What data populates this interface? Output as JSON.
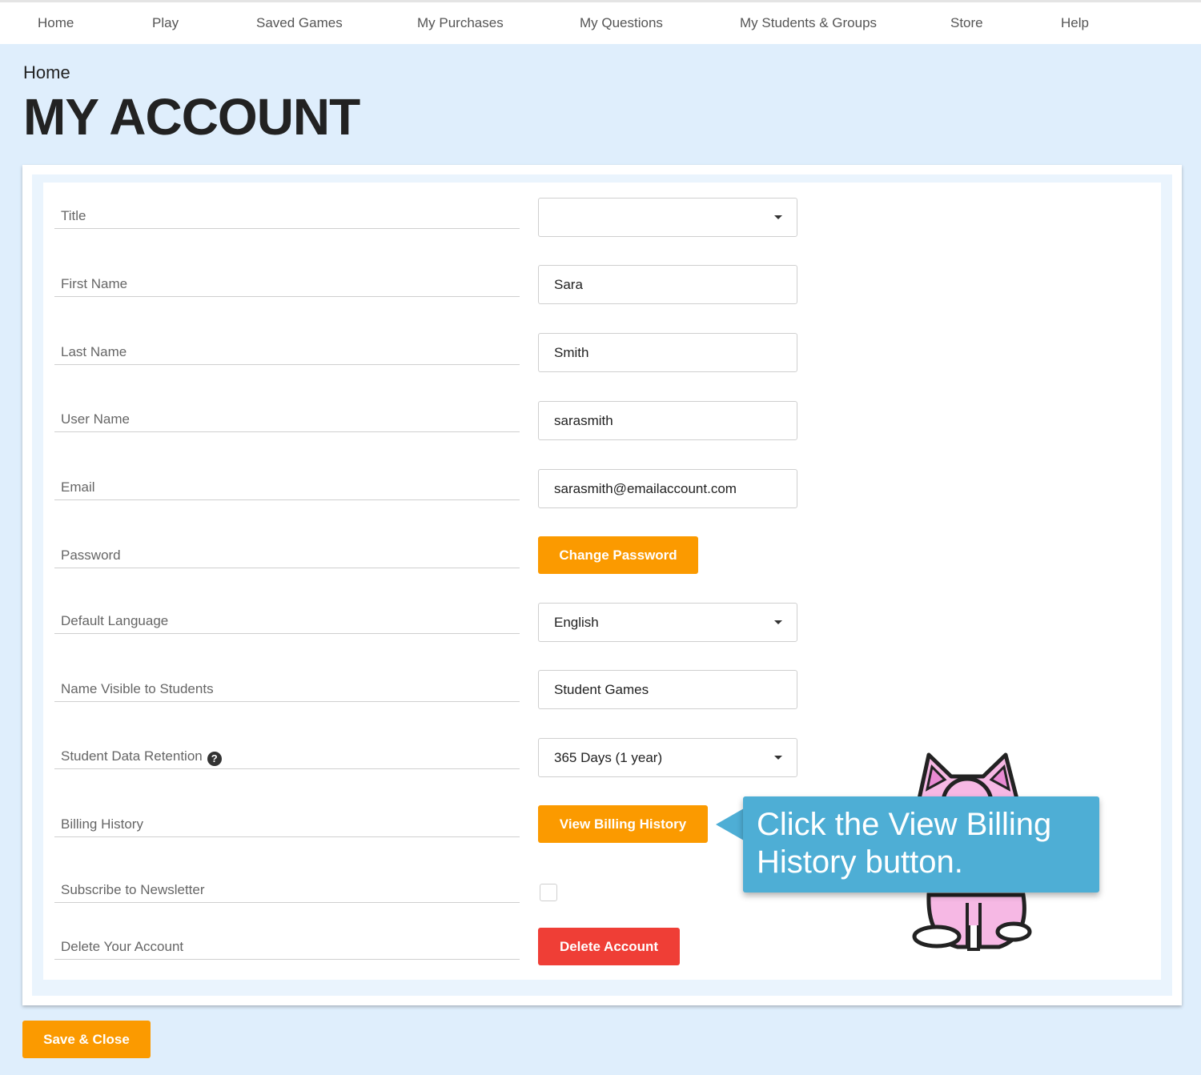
{
  "nav": {
    "items": [
      {
        "label": "Home"
      },
      {
        "label": "Play"
      },
      {
        "label": "Saved Games"
      },
      {
        "label": "My Purchases"
      },
      {
        "label": "My Questions"
      },
      {
        "label": "My Students & Groups"
      },
      {
        "label": "Store"
      },
      {
        "label": "Help"
      }
    ]
  },
  "breadcrumb": "Home",
  "page_title": "MY ACCOUNT",
  "form": {
    "title": {
      "label": "Title",
      "value": ""
    },
    "first_name": {
      "label": "First Name",
      "value": "Sara"
    },
    "last_name": {
      "label": "Last Name",
      "value": "Smith"
    },
    "user_name": {
      "label": "User Name",
      "value": "sarasmith"
    },
    "email": {
      "label": "Email",
      "value": "sarasmith@emailaccount.com"
    },
    "password": {
      "label": "Password",
      "button": "Change Password"
    },
    "default_language": {
      "label": "Default Language",
      "value": "English"
    },
    "name_visible": {
      "label": "Name Visible to Students",
      "value": "Student Games"
    },
    "data_retention": {
      "label": "Student Data Retention",
      "value": "365 Days (1 year)",
      "help_icon": "?"
    },
    "billing_history": {
      "label": "Billing History",
      "button": "View Billing History"
    },
    "newsletter": {
      "label": "Subscribe to Newsletter",
      "checked": false
    },
    "delete_account": {
      "label": "Delete Your Account",
      "button": "Delete Account"
    }
  },
  "footer": {
    "save_label": "Save & Close"
  },
  "callout": {
    "text": "Click the View Billing History button."
  },
  "icons": {
    "caret": "caret-down-icon",
    "help": "question-circle-icon",
    "mascot": "pink-cat-mascot"
  },
  "colors": {
    "page_bg": "#dfeefc",
    "primary_button": "#fb9a00",
    "danger_button": "#ef3e36",
    "callout_bg": "#4eaed5",
    "mascot_pink": "#f6b8e4"
  }
}
